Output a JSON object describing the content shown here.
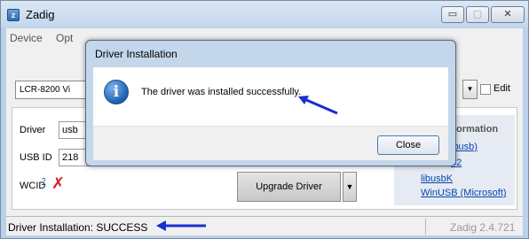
{
  "window": {
    "title": "Zadig",
    "icon_glyph": "z",
    "caption_buttons": {
      "minimize": "▭",
      "maximize": "▢",
      "close": "✕"
    }
  },
  "menu": {
    "device": "Device",
    "options": "Opt"
  },
  "device_combo": {
    "value": "LCR-8200 Vi",
    "dropdown_glyph": "▼"
  },
  "edit": {
    "label": "Edit",
    "checked": false
  },
  "fields": {
    "driver_label": "Driver",
    "driver_value": "usb",
    "usbid_label": "USB ID",
    "usbid_value": "218",
    "wcid_label": "WCID",
    "wcid_footnote": "?",
    "wcid_status": "✗"
  },
  "upgrade_button": {
    "label": "Upgrade Driver",
    "split_glyph": "▼"
  },
  "info_panel": {
    "title": "ormation",
    "links": [
      "ibusb)",
      "32",
      "libusbK",
      "WinUSB (Microsoft)"
    ]
  },
  "status_bar": {
    "text": "Driver Installation: SUCCESS",
    "version": "Zadig 2.4.721"
  },
  "dialog": {
    "title": "Driver Installation",
    "icon": "info-icon",
    "icon_glyph": "i",
    "message": "The driver was installed successfully.",
    "close_label": "Close"
  },
  "colors": {
    "annotation_arrow": "#1a2fcf",
    "error_mark": "#d42020",
    "link": "#0645ad"
  }
}
